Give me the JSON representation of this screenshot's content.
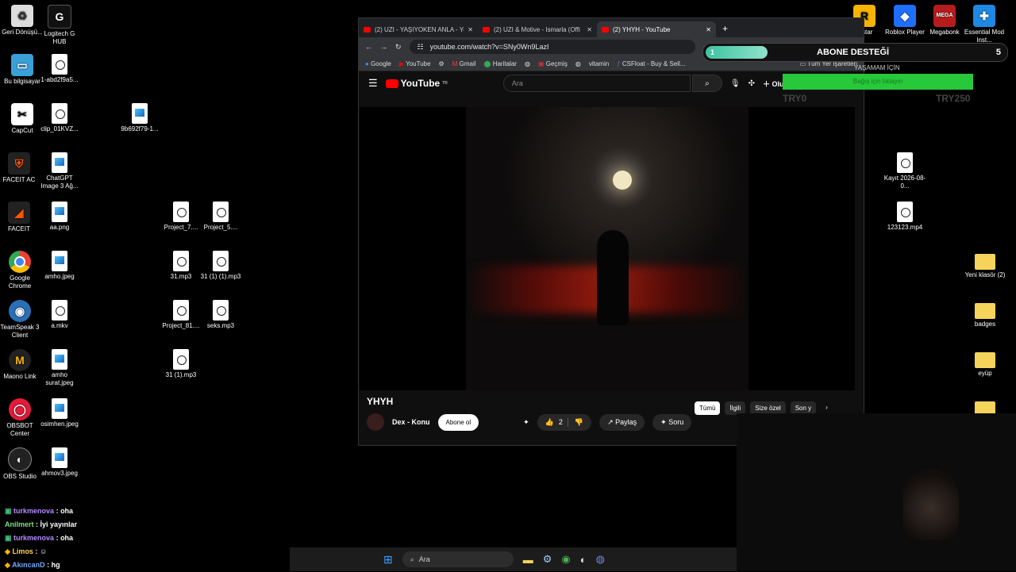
{
  "desktop": {
    "icons_left": [
      {
        "label": "Geri Dönüşü...",
        "icon": "recycle-bin-icon"
      },
      {
        "label": "Logitech G HUB",
        "icon": "logitech-icon"
      },
      {
        "label": "Bu bilgisayar",
        "icon": "computer-icon"
      },
      {
        "label": "1-abd2f9a5...",
        "icon": "file-icon"
      },
      {
        "label": "CapCut",
        "icon": "capcut-icon"
      },
      {
        "label": "clip_01KVZ...",
        "icon": "video-file-icon"
      },
      {
        "label": "9b692f79-1...",
        "icon": "image-file-icon"
      },
      {
        "label": "FACEIT AC",
        "icon": "faceit-ac-icon"
      },
      {
        "label": "ChatGPT Image 3 Ağ...",
        "icon": "image-file-icon"
      },
      {
        "label": "FACEIT",
        "icon": "faceit-icon"
      },
      {
        "label": "aa.png",
        "icon": "image-file-icon"
      },
      {
        "label": "Project_7....",
        "icon": "video-file-icon"
      },
      {
        "label": "Project_5....",
        "icon": "video-file-icon"
      },
      {
        "label": "Google Chrome",
        "icon": "chrome-icon"
      },
      {
        "label": "amho.jpeg",
        "icon": "image-file-icon"
      },
      {
        "label": "31.mp3",
        "icon": "audio-file-icon"
      },
      {
        "label": "31 (1) (1).mp3",
        "icon": "audio-file-icon"
      },
      {
        "label": "TeamSpeak 3 Client",
        "icon": "teamspeak-icon"
      },
      {
        "label": "a.mkv",
        "icon": "video-file-icon"
      },
      {
        "label": "Project_81....",
        "icon": "video-file-icon"
      },
      {
        "label": "seks.mp3",
        "icon": "audio-file-icon"
      },
      {
        "label": "Maono Link",
        "icon": "maono-icon"
      },
      {
        "label": "amho surat.jpeg",
        "icon": "image-file-icon"
      },
      {
        "label": "31 (1).mp3",
        "icon": "audio-file-icon"
      },
      {
        "label": "OBSBOT Center",
        "icon": "obsbot-icon"
      },
      {
        "label": "osimhen.jpeg",
        "icon": "image-file-icon"
      },
      {
        "label": "OBS Studio",
        "icon": "obs-icon"
      },
      {
        "label": "ahmov3.jpeg",
        "icon": "image-file-icon"
      }
    ],
    "icons_right": [
      {
        "label": "Roblox Player",
        "icon": "roblox-icon"
      },
      {
        "label": "Megabonk",
        "icon": "megabonk-icon"
      },
      {
        "label": "Essential Mod Inst...",
        "icon": "essential-icon"
      },
      {
        "label": "Kayıt 2026-08-0...",
        "icon": "video-file-icon"
      },
      {
        "label": "123123.mp4",
        "icon": "video-file-icon"
      },
      {
        "label": "Yeni klasör (2)",
        "icon": "folder-icon"
      },
      {
        "label": "badges",
        "icon": "folder-icon"
      },
      {
        "label": "eyüp",
        "icon": "folder-icon"
      }
    ],
    "partial_label": "kstar"
  },
  "browser": {
    "tabs": [
      {
        "title": "(2) UZI - YAŞIYOKEN ANLA - Yo"
      },
      {
        "title": "(2) UZI & Motive - Ismarla (Offi"
      },
      {
        "title": "(2) YHYH - YouTube"
      }
    ],
    "url": "youtube.com/watch?v=SNy0Wn9LazI",
    "bookmarks": [
      "Google",
      "YouTube",
      "Gmail",
      "Haritalar",
      "Geçmiş",
      "vitamin",
      "CSFloat - Buy & Sell...",
      "Tüm Yer İşaretleri"
    ],
    "youtube": {
      "logo": "YouTube",
      "region": "TR",
      "search_placeholder": "Ara",
      "create_label": "Oluştur",
      "video_title": "YHYH",
      "channel": "Dex - Konu",
      "subscribe": "Abone ol",
      "likes": "2",
      "share": "Paylaş",
      "ask": "Soru",
      "chips": [
        "Tümü",
        "İlgili",
        "Size özel",
        "Son y"
      ]
    }
  },
  "overlay": {
    "abone_title": "ABONE DESTEĞİ",
    "abone_progress_label": "1",
    "abone_goal": "5",
    "try_left": "TRY0",
    "try_right": "TRY250",
    "yasamam": "YAŞAMAM İÇİN",
    "green_text": "Bağış için tıklayın"
  },
  "chat": [
    {
      "user": "turkmenova",
      "msg": "oha"
    },
    {
      "user": "Anilmert",
      "msg": "İyi yayınlar"
    },
    {
      "user": "turkmenova",
      "msg": "oha"
    },
    {
      "user": "Limos",
      "msg": ""
    },
    {
      "user": "AkıncanD",
      "msg": "hg"
    }
  ],
  "taskbar": {
    "search": "Ara"
  }
}
